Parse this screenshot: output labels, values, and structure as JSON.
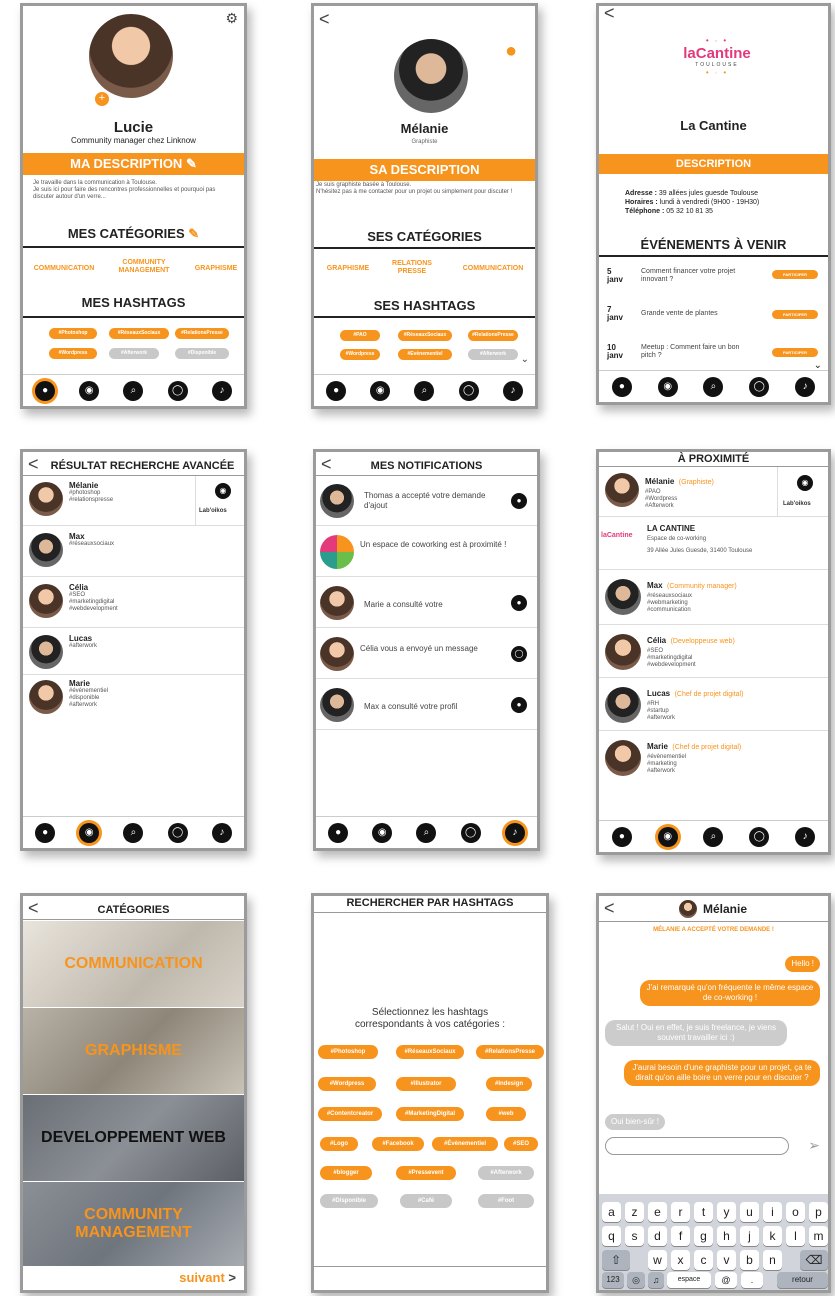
{
  "s1": {
    "name": "Lucie",
    "role": "Community manager chez Linknow",
    "desc_title": "MA DESCRIPTION",
    "desc": "Je travaille dans la communication à Toulouse.\nJe suis ici pour faire des rencontres professionnelles et pourquoi pas discuter autour d'un verre...",
    "cat_title": "MES CATÉGORIES",
    "cats": [
      "COMMUNICATION",
      "COMMUNITY MANAGEMENT",
      "GRAPHISME"
    ],
    "hash_title": "MES HASHTAGS",
    "tags": [
      "#Photoshop",
      "#RéseauxSociaux",
      "#RelationsPresse",
      "#Wordpress",
      "#Afterwork",
      "#Disponible"
    ]
  },
  "s2": {
    "name": "Mélanie",
    "role": "Graphiste",
    "desc_title": "SA DESCRIPTION",
    "desc": "Je suis graphiste basée à Toulouse.\nN'hésitez pas à me contacter pour un projet ou simplement pour discuter !",
    "cat_title": "SES CATÉGORIES",
    "cats": [
      "GRAPHISME",
      "RELATIONS PRESSE",
      "COMMUNICATION"
    ],
    "hash_title": "SES HASHTAGS",
    "tags": [
      "#PAO",
      "#RéseauxSociaux",
      "#RelationsPresse",
      "#Wordpress",
      "#Evènementiel",
      "#Afterwork"
    ]
  },
  "s3": {
    "logo": "laCantine",
    "logo_sub": "TOULOUSE",
    "title": "La Cantine",
    "desc_title": "DESCRIPTION",
    "addr_l": "Adresse :",
    "addr": " 39 allées jules guesde Toulouse",
    "hours_l": "Horaires :",
    "hours": " lundi à vendredi (9H00 - 19H30)",
    "tel_l": "Téléphone :",
    "tel": " 05 32 10 81 35",
    "ev_title": "ÉVÉNEMENTS À VENIR",
    "events": [
      {
        "day": "5",
        "mon": "janv",
        "text": "Comment financer votre projet innovant ?",
        "btn": "PARTICIPER"
      },
      {
        "day": "7",
        "mon": "janv",
        "text": "Grande vente de plantes",
        "btn": "PARTICIPER"
      },
      {
        "day": "10",
        "mon": "janv",
        "text": "Meetup : Comment faire un bon pitch ?",
        "btn": "PARTICIPER"
      }
    ]
  },
  "s4": {
    "title": "RÉSULTAT RECHERCHE AVANCÉE",
    "items": [
      {
        "name": "Mélanie",
        "tags": "#photoshop\n#relationspresse"
      },
      {
        "name": "Max",
        "tags": "#réseauxsociaux"
      },
      {
        "name": "Célia",
        "tags": "#SEO\n#marketingdigital\n#webdevelopment"
      },
      {
        "name": "Lucas",
        "tags": "#afterwork"
      },
      {
        "name": "Marie",
        "tags": "#événementiel\n#disponible\n#afterwork"
      }
    ],
    "badge": "Lab'oikos"
  },
  "s5": {
    "title": "MES NOTIFICATIONS",
    "items": [
      "Thomas a accepté votre demande d'ajout",
      "Un espace de coworking est à proximité !",
      "Marie a consulté votre",
      "Célia vous a envoyé un message",
      "Max a consulté votre profil"
    ]
  },
  "s6": {
    "title": "À PROXIMITÉ",
    "items": [
      {
        "name": "Mélanie",
        "role": "(Graphiste)",
        "tags": "#PAO\n#Wordpress\n#Afterwork"
      },
      {
        "name": "LA CANTINE",
        "role": "",
        "tags": "Espace de co-working\n\n39 Allée Jules Guesde, 31400 Toulouse"
      },
      {
        "name": "Max",
        "role": "(Community manager)",
        "tags": "#réseauxsociaux\n#webmarketing\n#communication"
      },
      {
        "name": "Célia",
        "role": "(Developpeuse web)",
        "tags": "#SEO\n#marketingdigital\n#webdevelopment"
      },
      {
        "name": "Lucas",
        "role": "(Chef de projet digital)",
        "tags": "#RH\n#startup\n#afterwork"
      },
      {
        "name": "Marie",
        "role": "(Chef de projet digital)",
        "tags": "#évènementiel\n#marketing\n#afterwork"
      }
    ],
    "badge": "Lab'oikos"
  },
  "s7": {
    "title": "CATÉGORIES",
    "cats": [
      "COMMUNICATION",
      "GRAPHISME",
      "DEVELOPPEMENT WEB",
      "COMMUNITY MANAGEMENT"
    ],
    "next": "suivant"
  },
  "s8": {
    "title": "RECHERCHER PAR HASHTAGS",
    "prompt": "Sélectionnez les hashtags correspondants à vos catégories :",
    "tags": [
      "#Photoshop",
      "#RéseauxSociaux",
      "#RelationsPresse",
      "#Wordpress",
      "#Illustrator",
      "#Indesign",
      "#Contentcreator",
      "#MarketingDigital",
      "#web",
      "#Logo",
      "#Facebook",
      "#Évènementiel",
      "#SEO",
      "#blogger",
      "#Pressevent",
      "#Afterwork",
      "#Disponible",
      "#Café",
      "#Foot"
    ]
  },
  "s9": {
    "name": "Mélanie",
    "accepted": "MÉLANIE A ACCEPTÉ VOTRE DEMANDE !",
    "msgs": [
      "Hello !",
      "J'ai remarqué qu'on fréquente le même espace de co-working !",
      "Salut ! Oui en effet, je suis freelance, je viens souvent travailler ici :)",
      "J'aurai besoin d'une graphiste pour un projet, ça te dirait qu'on aille boire un verre pour en discuter ?",
      "Oui bien-sûr !"
    ],
    "row1": [
      "a",
      "z",
      "e",
      "r",
      "t",
      "y",
      "u",
      "i",
      "o",
      "p"
    ],
    "row2": [
      "q",
      "s",
      "d",
      "f",
      "g",
      "h",
      "j",
      "k",
      "l",
      "m"
    ],
    "row3": [
      "w",
      "x",
      "c",
      "v",
      "b",
      "n"
    ],
    "k123": "123",
    "kspace": "espace",
    "kat": "@",
    "kdot": ".",
    "kret": "retour"
  }
}
